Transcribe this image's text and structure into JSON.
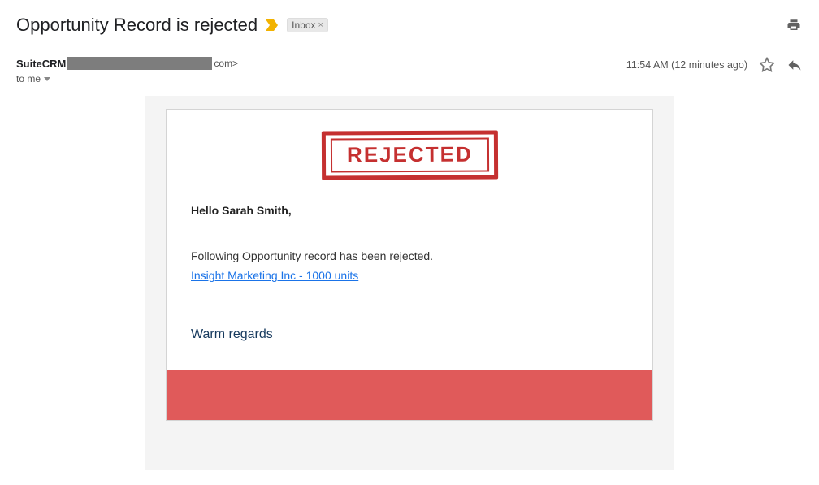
{
  "header": {
    "subject": "Opportunity Record is rejected",
    "inbox_label": "Inbox"
  },
  "meta": {
    "sender_name": "SuiteCRM",
    "sender_tail": "com>",
    "recipient_text": "to me",
    "timestamp": "11:54 AM (12 minutes ago)"
  },
  "email_body": {
    "stamp_text": "REJECTED",
    "greeting": "Hello Sarah Smith,",
    "message": "Following Opportunity record has been rejected.",
    "record_link_text": "Insight Marketing Inc - 1000 units",
    "signoff": "Warm regards"
  }
}
